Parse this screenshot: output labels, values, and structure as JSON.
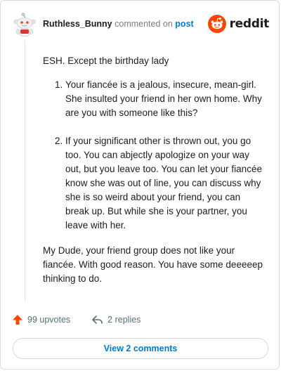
{
  "header": {
    "username": "Ruthless_Bunny",
    "action_text": "commented on",
    "post_link": "post",
    "brand": "reddit"
  },
  "comment": {
    "intro": "ESH. Except the birthday lady",
    "points": [
      "Your fiancée is a jealous, insecure, mean-girl. She insulted your friend in her own home. Why are you with someone like this?",
      "If your significant other is thrown out, you go too. You can abjectly apologize on your way out, but you leave too. You can let your fiancée know she was out of line, you can discuss why she is so weird about your friend, you can break up. But while she is your partner, you leave with her."
    ],
    "closing": "My Dude, your friend group does not like your fiancée. With good reason. You have some deeeeep thinking to do."
  },
  "footer": {
    "upvotes": "99 upvotes",
    "replies": "2 replies",
    "view_comments": "View 2 comments"
  },
  "colors": {
    "accent": "#0079d3",
    "reddit_orange": "#ff4500",
    "muted": "#576f76"
  },
  "icons": {
    "upvote": "upvote-arrow-icon",
    "reply": "reply-arrow-icon",
    "brand": "reddit-snoo-icon"
  }
}
